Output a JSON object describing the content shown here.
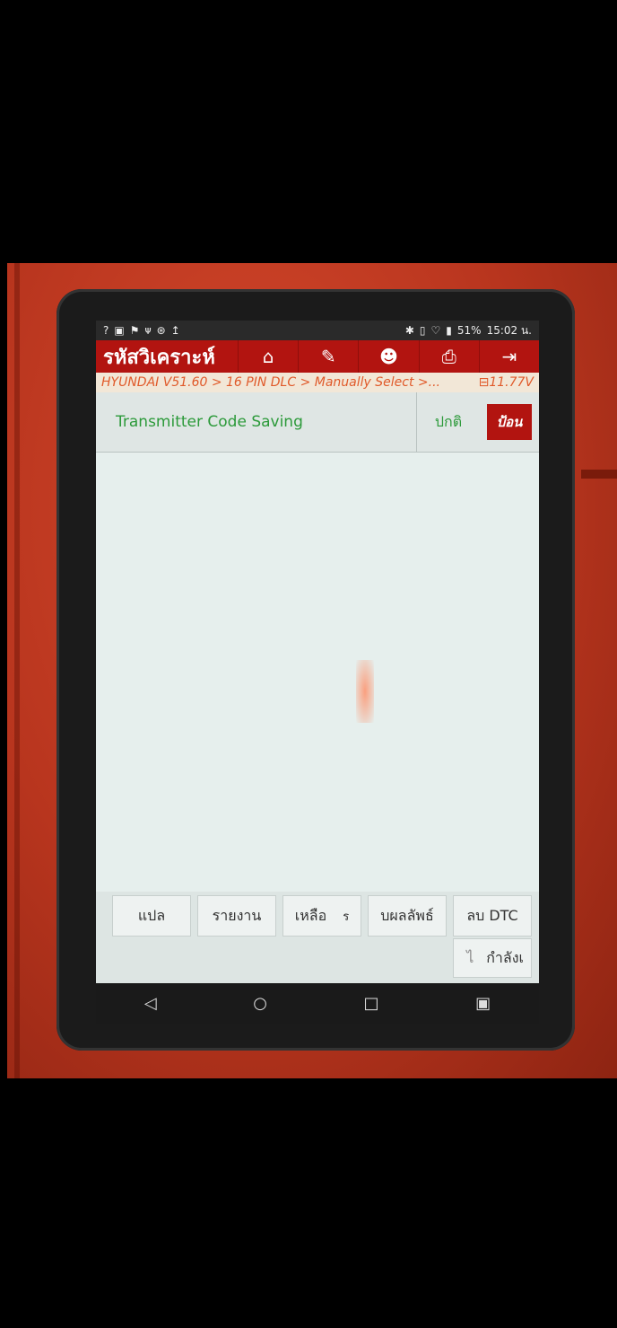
{
  "status_bar": {
    "left_icons": [
      "?",
      "▣",
      "⚑",
      "ᴪ",
      "⊛",
      "↥"
    ],
    "right_icons": [
      "✱",
      "▯",
      "♡",
      "▮"
    ],
    "battery": "51%",
    "time": "15:02 น."
  },
  "titlebar": {
    "title": "รหัสวิเคราะห์",
    "buttons": [
      "home-icon",
      "edit-icon",
      "user-icon",
      "print-icon",
      "exit-icon"
    ]
  },
  "breadcrumb": {
    "path": "HYUNDAI V51.60 > 16 PIN DLC > Manually Select >...",
    "voltage": "11.77V"
  },
  "rows": [
    {
      "name": "Transmitter Code Saving",
      "status": "ปกติ",
      "input_label": "ป้อน"
    }
  ],
  "bottom_buttons": {
    "translate": "แปล",
    "report": "รายงาน",
    "remaining": "เหลือ",
    "remaining_suffix": "ร",
    "result": "บผลลัพธ์",
    "clear_dtc": "ลบ DTC",
    "status_prefix": "ไ",
    "status": "กำลังเ"
  },
  "navbar": [
    "◁",
    "○",
    "□",
    "▣"
  ],
  "colors": {
    "accent": "#b21410",
    "ok": "#2c9a3a",
    "crumb": "#e05a2a"
  }
}
